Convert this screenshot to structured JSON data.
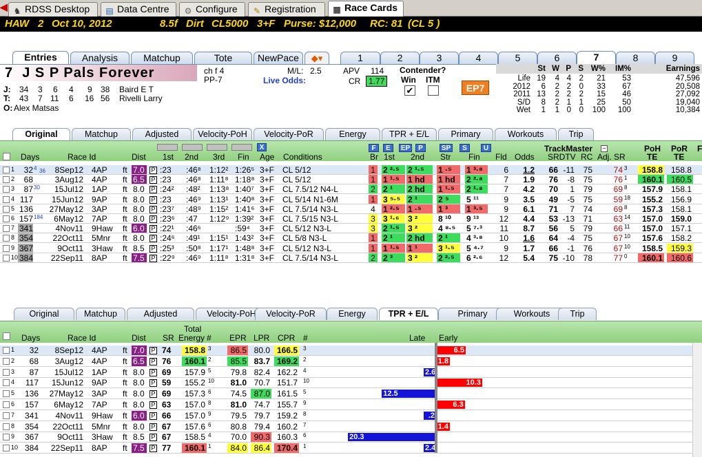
{
  "top_tabs": [
    "RDSS Desktop",
    "Data Centre",
    "Configure",
    "Registration",
    "Race Cards"
  ],
  "race_header": {
    "track": "HAW",
    "race": "2",
    "date": "Oct 10, 2012",
    "distance": "8.5f",
    "surface": "Dirt",
    "class": "CL5000",
    "age": "3+F",
    "purse": "Purse: $12,000",
    "rc": "RC: 81",
    "cl": "(CL 5 )"
  },
  "entry_tabs": [
    "Entries",
    "Analysis",
    "Matchup",
    "Tote",
    "NewPace"
  ],
  "post_tabs": [
    "1",
    "2",
    "3",
    "4",
    "5",
    "6",
    "7",
    "8",
    "9"
  ],
  "horse": {
    "number": "7",
    "name": "J S P Pals Forever",
    "sex_age": "ch f 4",
    "pp": "PP-7",
    "ml_label": "M/L:",
    "ml": "2.5",
    "live_odds": "Live Odds:",
    "apv_label": "APV",
    "apv": "114",
    "cr_label": "CR",
    "cr": "1.77",
    "contender": "Contender?",
    "win": "Win",
    "itm": "ITM",
    "ep_badge": "EP7",
    "jockey": {
      "label": "J:",
      "stats": [
        "34",
        "3",
        "6",
        "4",
        "9",
        "38"
      ],
      "name": "Baird E T"
    },
    "trainer": {
      "label": "T:",
      "stats": [
        "43",
        "7",
        "11",
        "6",
        "16",
        "56"
      ],
      "name": "Rivelli Larry"
    },
    "owner": {
      "label": "O:",
      "name": "Alex Matsas"
    }
  },
  "stats": {
    "headers": [
      "St",
      "W",
      "P",
      "S",
      "W%",
      "IM%",
      "Earnings"
    ],
    "rows": [
      [
        "Life",
        "19",
        "4",
        "4",
        "2",
        "21",
        "53",
        "47,596"
      ],
      [
        "2012",
        "6",
        "2",
        "2",
        "0",
        "33",
        "67",
        "20,508"
      ],
      [
        "2011",
        "13",
        "2",
        "2",
        "2",
        "15",
        "46",
        "27,092"
      ],
      [
        "S/D",
        "8",
        "2",
        "1",
        "1",
        "25",
        "50",
        "19,040"
      ],
      [
        "Wet",
        "1",
        "1",
        "0",
        "0",
        "100",
        "100",
        "10,384"
      ]
    ]
  },
  "sub_tabs": [
    "Original",
    "Matchup",
    "Adjusted",
    "Velocity-PoH",
    "Velocity-PoR",
    "Energy",
    "TPR + E/L",
    "Primary",
    "Workouts",
    "Trip"
  ],
  "grid1": {
    "headers": {
      "days": "Days",
      "raceid": "Race Id",
      "dist": "Dist",
      "c1": "1st",
      "c2": "2nd",
      "c3": "3rd",
      "fin": "Fin",
      "age": "Age",
      "cond": "Conditions",
      "br": "Br",
      "p1": "1st",
      "p2": "2nd",
      "str": "Str",
      "pfin": "Fin",
      "fld": "Fld",
      "odds": "Odds",
      "tm": "TrackMaster",
      "srdtv": "SRDTV",
      "rc": "RC",
      "adj": "Adj. SR",
      "poh": "PoH",
      "por": "PoR",
      "te": "TE",
      "te2": "TE",
      "x": "X",
      "pace_btns": [
        "F",
        "E",
        "EP",
        "P",
        "SP",
        "S",
        "U"
      ],
      "f_trunc": "F"
    },
    "rows": [
      {
        "n": "1",
        "days": "32",
        "sup": "4",
        "days2": "36",
        "date": "8Sep12",
        "race": "4AP",
        "ft": "ft",
        "dist": "7.0",
        "c1": ":23",
        "c2": ":46⁸",
        "c3": "1:12²",
        "fin": "1:26⁵",
        "age": "3+F",
        "cond": "CL 5/12",
        "br": "1",
        "p1": "2 ²·⁵",
        "p2": "2 ¹·⁵",
        "str": "1 ·⁵",
        "pfin": "1 ³·⁸",
        "fld": "6",
        "odds": "1.2",
        "tm": "66",
        "srdtv": "-11",
        "rc": "75",
        "adj": "74",
        "adjs": "3",
        "poh": "158.8",
        "por": "158.8"
      },
      {
        "n": "2",
        "days": "68",
        "date": "3Aug12",
        "race": "4AP",
        "ft": "ft",
        "dist": "6.5",
        "c1": ":23",
        "c2": ":46⁸",
        "c3": "1:11⁸",
        "fin": "1:18⁸",
        "age": "3+F",
        "cond": "CL 5/12",
        "br": "1",
        "p1": "1 ¹·⁵",
        "p2": "1 hd",
        "str": "1 hd",
        "pfin": "2 ²·⁸",
        "fld": "7",
        "odds": "1.9",
        "tm": "76",
        "srdtv": "-8",
        "rc": "75",
        "adj": "76",
        "adjs": "1",
        "poh": "160.1",
        "por": "160.5"
      },
      {
        "n": "3",
        "days": "87",
        "sup": "30",
        "date": "15Jul12",
        "race": "1AP",
        "ft": "ft",
        "dist": "8.0",
        "c1": ":24²",
        "c2": ":48²",
        "c3": "1:13⁸",
        "fin": "1:40⁷",
        "age": "3+F",
        "cond": "CL 7.5/12 N4-L",
        "br": "2",
        "p1": "2 ¹",
        "p2": "2 hd",
        "str": "1 ¹·⁵",
        "pfin": "2 ¹·⁸",
        "fld": "7",
        "odds": "4.2",
        "tm": "70",
        "srdtv": "1",
        "rc": "79",
        "adj": "69",
        "adjs": "8",
        "poh": "157.9",
        "por": "158.1"
      },
      {
        "n": "4",
        "days": "117",
        "date": "15Jun12",
        "race": "9AP",
        "ft": "ft",
        "dist": "8.0",
        "c1": ":23",
        "c2": ":46⁹",
        "c3": "1:13¹",
        "fin": "1:40⁸",
        "age": "3+F",
        "cond": "CL 5/14 N1-6M",
        "br": "1",
        "p1": "3 ⁵·⁵",
        "p2": "2 ¹",
        "str": "2 ⁵",
        "pfin": "5 ¹¹",
        "fld": "9",
        "odds": "3.5",
        "tm": "49",
        "srdtv": "-5",
        "rc": "75",
        "adj": "59",
        "adjs": "18",
        "poh": "155.2",
        "por": "156.9"
      },
      {
        "n": "5",
        "days": "136",
        "date": "27May12",
        "race": "3AP",
        "ft": "ft",
        "dist": "8.0",
        "c1": ":23⁷",
        "c2": ":48⁹",
        "c3": "1:15²",
        "fin": "1:41⁶",
        "age": "3+F",
        "cond": "CL 7.5/14 N3-L",
        "br": "4",
        "p1": "1 ²·⁵",
        "p2": "1 ·⁵",
        "str": "1 ³",
        "pfin": "1 ³·⁵",
        "fld": "9",
        "odds": "6.1",
        "tm": "71",
        "srdtv": "7",
        "rc": "74",
        "adj": "69",
        "adjs": "8",
        "poh": "157.3",
        "por": "158.1"
      },
      {
        "n": "6",
        "days": "157",
        "sup": "184",
        "date": "6May12",
        "race": "7AP",
        "ft": "ft",
        "dist": "8.0",
        "c1": ":23⁶",
        "c2": ":47",
        "c3": "1:12⁹",
        "fin": "1:39²",
        "age": "3+F",
        "cond": "CL 7.5/15 N3-L",
        "br": "3",
        "p1": "3 ¹·⁶",
        "p2": "3 ²",
        "str": "8 ¹⁰",
        "pfin": "9 ¹³",
        "fld": "12",
        "odds": "4.4",
        "tm": "53",
        "srdtv": "-13",
        "rc": "71",
        "adj": "63",
        "adjs": "14",
        "poh": "157.0",
        "por": "159.0"
      },
      {
        "n": "7",
        "days": "341",
        "date": "4Nov11",
        "race": "9Haw",
        "ft": "ft",
        "dist": "6.0",
        "c1": ":22¹",
        "c2": ":46⁶",
        "c3": "",
        ":fin": "",
        "fin": ":59⁴",
        "age": "3+F",
        "cond": "CL 5/12 N3-L",
        "br": "3",
        "p1": "2 ¹·⁵",
        "p2": "3 ²",
        "str": "4 ⁸·⁵",
        "pfin": "5 ⁷·³",
        "fld": "11",
        "odds": "8.7",
        "tm": "56",
        "srdtv": "5",
        "rc": "79",
        "adj": "66",
        "adjs": "11",
        "poh": "157.0",
        "por": "157.1"
      },
      {
        "n": "8",
        "days": "354",
        "date": "22Oct11",
        "race": "5Mnr",
        "ft": "ft",
        "dist": "8.0",
        "c1": ":24⁶",
        "c2": ":49¹",
        "c3": "1:15¹",
        "fin": "1:43²",
        "age": "3+F",
        "cond": "CL 5/8 N3-L",
        "br": "1",
        "p1": "2 ¹",
        "p2": "2 hd",
        "str": "2 ¹",
        "pfin": "4 ³·⁸",
        "fld": "10",
        "odds": "1.6",
        "tm": "64",
        "srdtv": "-4",
        "rc": "75",
        "adj": "67",
        "adjs": "10",
        "poh": "157.6",
        "por": "158.2"
      },
      {
        "n": "9",
        "days": "367",
        "date": "9Oct11",
        "race": "3Haw",
        "ft": "ft",
        "dist": "8.5",
        "c1": ":25³",
        "c2": ":50⁸",
        "c3": "1:17¹",
        "fin": "1:48⁸",
        "age": "3+F",
        "cond": "CL 5/12 N3-L",
        "br": "1",
        "p1": "1 ¹·⁵",
        "p2": "1 ¹",
        "str": "3 ¹·⁵",
        "pfin": "5 ⁴·⁷",
        "fld": "9",
        "odds": "1.7",
        "tm": "66",
        "srdtv": "-1",
        "rc": "76",
        "adj": "67",
        "adjs": "10",
        "poh": "158.5",
        "por": "159.3"
      },
      {
        "n": "10",
        "days": "384",
        "date": "22Sep11",
        "race": "8AP",
        "ft": "ft",
        "dist": "7.5",
        "c1": ":22⁹",
        "c2": ":46⁹",
        "c3": "1:11⁸",
        "fin": "1:31⁸",
        "age": "3+F",
        "cond": "CL 7.5/14 N3-L",
        "br": "2",
        "p1": "2 ³",
        "p2": "3 ²",
        "str": "2 ²·⁵",
        "pfin": "6 ²·⁶",
        "fld": "12",
        "odds": "5.4",
        "tm": "75",
        "srdtv": "-10",
        "rc": "78",
        "adj": "77",
        "adjs": "0",
        "poh": "160.1",
        "por": "160.6"
      }
    ]
  },
  "grid2": {
    "headers": {
      "days": "Days",
      "raceid": "Race Id",
      "dist": "Dist",
      "sr": "SR",
      "total": "Total",
      "energy": "Energy",
      "hash": "#",
      "epr": "EPR",
      "lpr": "LPR",
      "cpr": "CPR",
      "hash2": "#",
      "late": "Late",
      "early": "Early"
    },
    "rows": [
      {
        "n": "1",
        "days": "32",
        "date": "8Sep12",
        "race": "4AP",
        "ft": "ft",
        "dist": "7.0",
        "sr": "74",
        "energy": "158.8",
        "er": "3",
        "epr": "86.5",
        "lpr": "80.0",
        "cpr": "166.5",
        "cr": "3",
        "bar": 6.5,
        "barlbl": "6.5"
      },
      {
        "n": "2",
        "days": "68",
        "date": "3Aug12",
        "race": "4AP",
        "ft": "ft",
        "dist": "6.5",
        "sr": "76",
        "energy": "160.1",
        "er": "2",
        "epr": "85.5",
        "lpr": "83.7",
        "cpr": "169.2",
        "cr": "2",
        "bar": 1.8,
        "barlbl": "1.8"
      },
      {
        "n": "3",
        "days": "87",
        "date": "15Jul12",
        "race": "1AP",
        "ft": "ft",
        "dist": "8.0",
        "sr": "69",
        "energy": "157.9",
        "er": "5",
        "epr": "79.8",
        "lpr": "82.4",
        "cpr": "162.2",
        "cr": "4",
        "bar": -2.6,
        "barlbl": "2.6"
      },
      {
        "n": "4",
        "days": "117",
        "date": "15Jun12",
        "race": "9AP",
        "ft": "ft",
        "dist": "8.0",
        "sr": "59",
        "energy": "155.2",
        "er": "10",
        "epr": "81.0",
        "lpr": "70.7",
        "cpr": "151.7",
        "cr": "10",
        "bar": 10.3,
        "barlbl": "10.3"
      },
      {
        "n": "5",
        "days": "136",
        "date": "27May12",
        "race": "3AP",
        "ft": "ft",
        "dist": "8.0",
        "sr": "69",
        "energy": "157.3",
        "er": "6",
        "epr": "74.5",
        "lpr": "87.0",
        "cpr": "161.5",
        "cr": "5",
        "bar": -12.5,
        "barlbl": "12.5"
      },
      {
        "n": "6",
        "days": "157",
        "date": "6May12",
        "race": "7AP",
        "ft": "ft",
        "dist": "8.0",
        "sr": "63",
        "energy": "157.0",
        "er": "8",
        "epr": "81.0",
        "lpr": "74.7",
        "cpr": "155.7",
        "cr": "9",
        "bar": 6.3,
        "barlbl": "6.3"
      },
      {
        "n": "7",
        "days": "341",
        "date": "4Nov11",
        "race": "9Haw",
        "ft": "ft",
        "dist": "6.0",
        "sr": "66",
        "energy": "157.0",
        "er": "9",
        "epr": "79.5",
        "lpr": "79.7",
        "cpr": "159.2",
        "cr": "8",
        "bar": -0.2,
        "barlbl": ".2"
      },
      {
        "n": "8",
        "days": "354",
        "date": "22Oct11",
        "race": "5Mnr",
        "ft": "ft",
        "dist": "8.0",
        "sr": "67",
        "energy": "157.6",
        "er": "6",
        "epr": "80.8",
        "lpr": "79.4",
        "cpr": "160.2",
        "cr": "7",
        "bar": 1.4,
        "barlbl": "1.4"
      },
      {
        "n": "9",
        "days": "367",
        "date": "9Oct11",
        "race": "3Haw",
        "ft": "ft",
        "dist": "8.5",
        "sr": "67",
        "energy": "158.5",
        "er": "4",
        "epr": "70.0",
        "lpr": "90.3",
        "cpr": "160.3",
        "cr": "6",
        "bar": -20.3,
        "barlbl": "20.3"
      },
      {
        "n": "10",
        "days": "384",
        "date": "22Sep11",
        "race": "8AP",
        "ft": "ft",
        "dist": "7.5",
        "sr": "77",
        "energy": "160.1",
        "er": "1",
        "epr": "84.0",
        "lpr": "86.4",
        "cpr": "170.4",
        "cr": "1",
        "bar": -2.4,
        "barlbl": "2.4"
      }
    ]
  }
}
